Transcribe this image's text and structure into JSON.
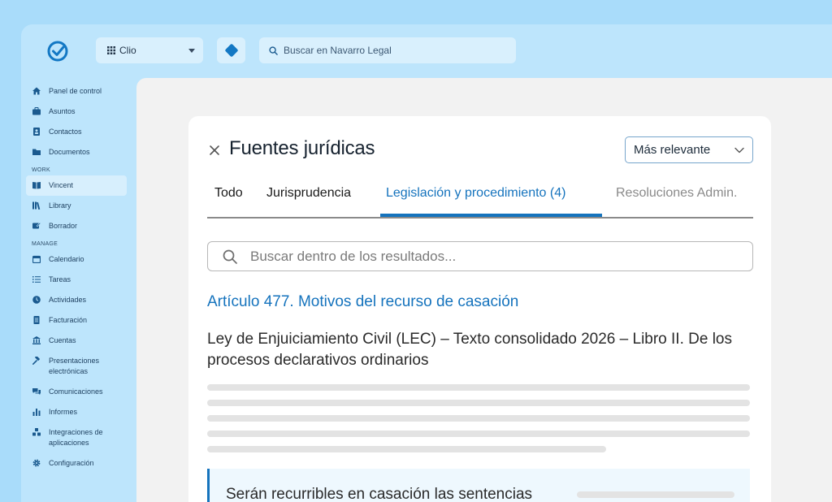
{
  "header": {
    "app_selector": "Clio",
    "search_placeholder": "Buscar en Navarro Legal"
  },
  "sidebar": {
    "items_top": [
      {
        "label": "Panel de control",
        "icon": "home-icon"
      },
      {
        "label": "Asuntos",
        "icon": "briefcase-icon"
      },
      {
        "label": "Contactos",
        "icon": "contact-card-icon"
      },
      {
        "label": "Documentos",
        "icon": "folder-icon"
      }
    ],
    "section_work": "WORK",
    "items_work": [
      {
        "label": "Vincent",
        "icon": "book-icon",
        "active": true
      },
      {
        "label": "Library",
        "icon": "library-icon"
      },
      {
        "label": "Borrador",
        "icon": "draft-icon"
      }
    ],
    "section_manage": "MANAGE",
    "items_manage": [
      {
        "label": "Calendario",
        "icon": "calendar-icon"
      },
      {
        "label": "Tareas",
        "icon": "list-icon"
      },
      {
        "label": "Actividades",
        "icon": "clock-icon"
      },
      {
        "label": "Facturación",
        "icon": "invoice-icon"
      },
      {
        "label": "Cuentas",
        "icon": "bank-icon"
      },
      {
        "label": "Presentaciones electrónicas",
        "icon": "gavel-icon"
      },
      {
        "label": "Comunicaciones",
        "icon": "chat-icon"
      },
      {
        "label": "Informes",
        "icon": "bar-chart-icon"
      },
      {
        "label": "Integraciones de aplicaciones",
        "icon": "integrations-icon"
      },
      {
        "label": "Configuración",
        "icon": "gear-icon"
      }
    ]
  },
  "panel": {
    "title": "Fuentes jurídicas",
    "sort_label": "Más relevante",
    "tabs": [
      {
        "label": "Todo"
      },
      {
        "label": "Jurisprudencia"
      },
      {
        "label": "Legislación y procedimiento (4)",
        "active": true
      },
      {
        "label": "Resoluciones Admin."
      }
    ],
    "search_placeholder": "Buscar dentro de los resultados...",
    "result": {
      "title": "Artículo 477. Motivos del recurso de casación",
      "source": "Ley de Enjuiciamiento Civil (LEC) – Texto consolidado 2026 – Libro II. De los procesos declarativos ordinarios",
      "quote": "Serán recurribles en casación las sentencias"
    }
  },
  "colors": {
    "accent": "#1573bd",
    "sidebar_bg": "#bde5fc",
    "page_bg": "#a9dcfa"
  }
}
